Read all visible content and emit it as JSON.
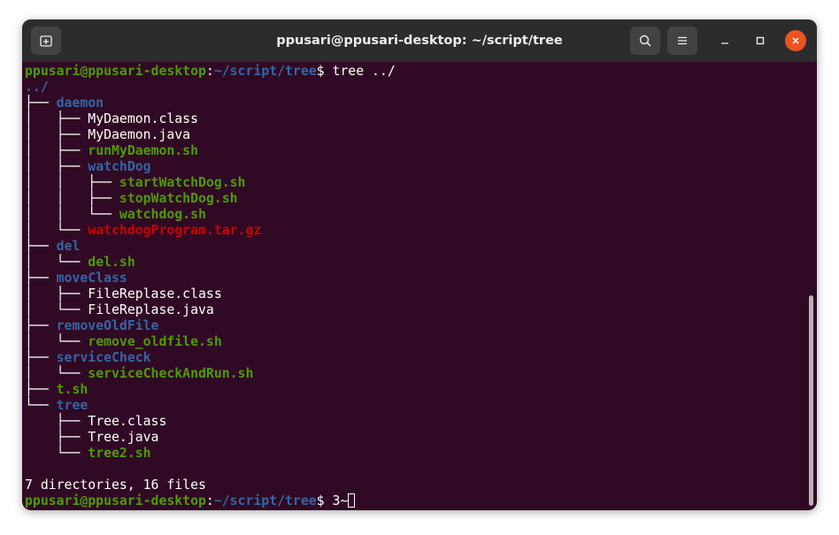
{
  "window": {
    "title": "ppusari@ppusari-desktop: ~/script/tree"
  },
  "colors": {
    "background": "#300a24",
    "prompt_user": "#4e9a06",
    "prompt_path": "#3465a4",
    "directory": "#3465a4",
    "executable": "#4e9a06",
    "archive": "#cc0000",
    "text": "#ffffff"
  },
  "icons": {
    "new_tab": "new-tab-icon",
    "search": "search-icon",
    "menu": "hamburger-menu-icon",
    "minimize": "minimize-icon",
    "maximize": "maximize-icon",
    "close": "close-icon"
  },
  "prompt": {
    "user_host": "ppusari@ppusari-desktop",
    "colon": ":",
    "path": "~/script/tree",
    "symbol": "$ "
  },
  "command": "tree ../",
  "tree": [
    {
      "prefix": "",
      "name": "../",
      "kind": "dir"
    },
    {
      "prefix": "├── ",
      "name": "daemon",
      "kind": "dir"
    },
    {
      "prefix": "│   ├── ",
      "name": "MyDaemon.class",
      "kind": "file"
    },
    {
      "prefix": "│   ├── ",
      "name": "MyDaemon.java",
      "kind": "file"
    },
    {
      "prefix": "│   ├── ",
      "name": "runMyDaemon.sh",
      "kind": "exec"
    },
    {
      "prefix": "│   ├── ",
      "name": "watchDog",
      "kind": "dir"
    },
    {
      "prefix": "│   │   ├── ",
      "name": "startWatchDog.sh",
      "kind": "exec"
    },
    {
      "prefix": "│   │   ├── ",
      "name": "stopWatchDog.sh",
      "kind": "exec"
    },
    {
      "prefix": "│   │   └── ",
      "name": "watchdog.sh",
      "kind": "exec"
    },
    {
      "prefix": "│   └── ",
      "name": "watchdogProgram.tar.gz",
      "kind": "archive"
    },
    {
      "prefix": "├── ",
      "name": "del",
      "kind": "dir"
    },
    {
      "prefix": "│   └── ",
      "name": "del.sh",
      "kind": "exec"
    },
    {
      "prefix": "├── ",
      "name": "moveClass",
      "kind": "dir"
    },
    {
      "prefix": "│   ├── ",
      "name": "FileReplase.class",
      "kind": "file"
    },
    {
      "prefix": "│   └── ",
      "name": "FileReplase.java",
      "kind": "file"
    },
    {
      "prefix": "├── ",
      "name": "removeOldFile",
      "kind": "dir"
    },
    {
      "prefix": "│   └── ",
      "name": "remove_oldfile.sh",
      "kind": "exec"
    },
    {
      "prefix": "├── ",
      "name": "serviceCheck",
      "kind": "dir"
    },
    {
      "prefix": "│   └── ",
      "name": "serviceCheckAndRun.sh",
      "kind": "exec"
    },
    {
      "prefix": "├── ",
      "name": "t.sh",
      "kind": "exec"
    },
    {
      "prefix": "└── ",
      "name": "tree",
      "kind": "dir"
    },
    {
      "prefix": "    ├── ",
      "name": "Tree.class",
      "kind": "file"
    },
    {
      "prefix": "    ├── ",
      "name": "Tree.java",
      "kind": "file"
    },
    {
      "prefix": "    └── ",
      "name": "tree2.sh",
      "kind": "exec"
    }
  ],
  "summary": "7 directories, 16 files",
  "current_input": "3~"
}
